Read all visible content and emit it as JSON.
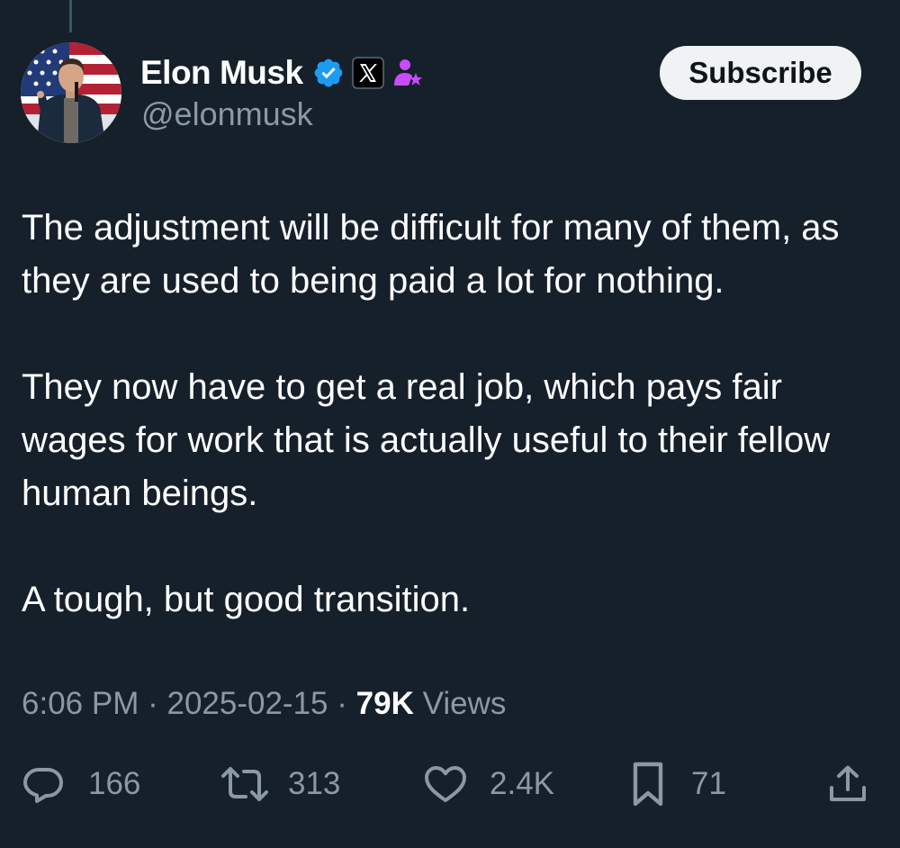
{
  "author": {
    "display_name": "Elon Musk",
    "handle": "@elonmusk",
    "badges": [
      "verified-checkmark-icon",
      "x-affiliate-icon",
      "admin-person-star-icon"
    ]
  },
  "subscribe_label": "Subscribe",
  "tweet": {
    "paragraphs": [
      "The adjustment will be difficult for many of them, as they are used to being paid a lot for nothing.",
      "They now have to get a real job, which pays fair wages for work that is actually useful to their fellow human beings.",
      "A tough, but good transition."
    ]
  },
  "meta": {
    "time": "6:06 PM",
    "separator": "·",
    "date": "2025-02-15",
    "views_count": "79K",
    "views_label": "Views"
  },
  "actions": {
    "replies": "166",
    "reposts": "313",
    "likes": "2.4K",
    "bookmarks": "71"
  },
  "colors": {
    "background": "#15202b",
    "text": "#ffffff",
    "secondary": "#8b98a5",
    "verified": "#1d9bf0",
    "admin_badge": "#c94cff"
  }
}
